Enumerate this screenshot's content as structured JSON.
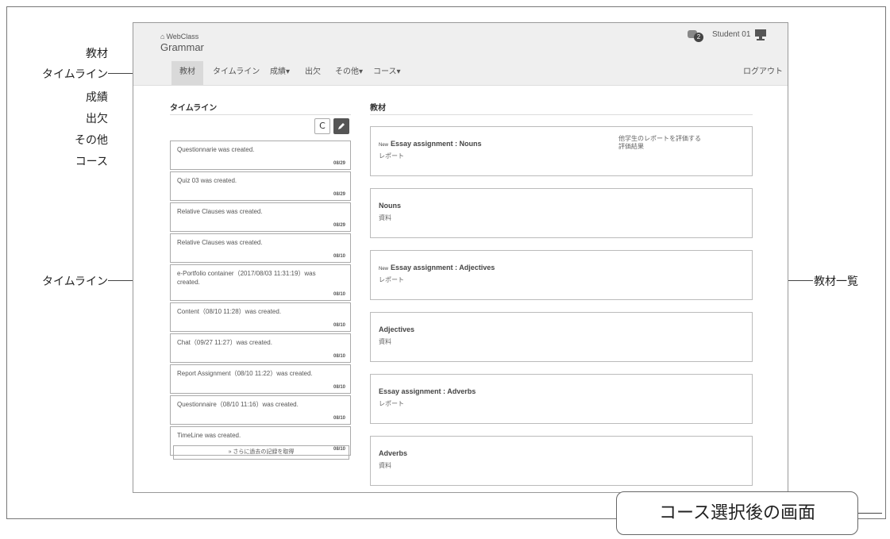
{
  "header": {
    "brand": "WebClass",
    "course_title": "Grammar",
    "notification_count": "2",
    "user_name": "Student 01",
    "logout": "ログアウト"
  },
  "nav": {
    "items": [
      {
        "label": "教材"
      },
      {
        "label": "タイムライン"
      },
      {
        "label": "成績▾"
      },
      {
        "label": "出欠"
      },
      {
        "label": "その他▾"
      },
      {
        "label": "コース▾"
      }
    ]
  },
  "timeline": {
    "title": "タイムライン",
    "refresh_icon": "C",
    "items": [
      {
        "text": "Questionnarie was created.",
        "date": "08/29"
      },
      {
        "text": "Quiz 03 was created.",
        "date": "08/29"
      },
      {
        "text": "Relative Clauses was created.",
        "date": "08/29"
      },
      {
        "text": "Relative Clauses was created.",
        "date": "08/10"
      },
      {
        "text": "e-Portfolio container（2017/08/03 11:31:19）was created.",
        "date": "08/10"
      },
      {
        "text": "Content（08/10 11:28）was created.",
        "date": "08/10"
      },
      {
        "text": "Chat（09/27 11:27）was created.",
        "date": "08/10"
      },
      {
        "text": "Report Assignment（08/10 11:22）was created.",
        "date": "08/10"
      },
      {
        "text": "Questionnaire（08/10 11:16）was created.",
        "date": "08/10"
      },
      {
        "text": "TimeLine was created.",
        "date": "08/10"
      }
    ],
    "more_label": "» さらに過去の記録を取得"
  },
  "materials": {
    "title": "教材",
    "items": [
      {
        "new": "New",
        "title": "Essay assignment : Nouns",
        "type": "レポート",
        "link1": "他学生のレポートを評価する",
        "link2": "評価結果"
      },
      {
        "new": "",
        "title": "Nouns",
        "type": "資料",
        "link1": "",
        "link2": ""
      },
      {
        "new": "New",
        "title": "Essay assignment : Adjectives",
        "type": "レポート",
        "link1": "",
        "link2": ""
      },
      {
        "new": "",
        "title": "Adjectives",
        "type": "資料",
        "link1": "",
        "link2": ""
      },
      {
        "new": "",
        "title": "Essay assignment : Adverbs",
        "type": "レポート",
        "link1": "",
        "link2": ""
      },
      {
        "new": "",
        "title": "Adverbs",
        "type": "資料",
        "link1": "",
        "link2": ""
      }
    ]
  },
  "annotations": {
    "nav_labels": [
      "教材",
      "タイムライン",
      "成績",
      "出欠",
      "その他",
      "コース"
    ],
    "timeline_label": "タイムライン",
    "materials_label": "教材一覧",
    "caption": "コース選択後の画面"
  }
}
